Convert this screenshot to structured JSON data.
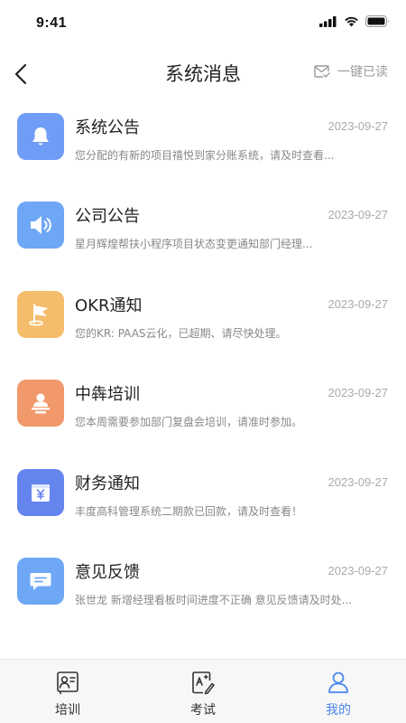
{
  "status_bar": {
    "time": "9:41"
  },
  "header": {
    "title": "系统消息",
    "mark_all_read": "一键已读"
  },
  "messages": [
    {
      "title": "系统公告",
      "date": "2023-09-27",
      "preview": "您分配的有新的项目禧悦到家分账系统，请及时查看...",
      "icon": "bell-icon",
      "color": "#6f9cf6"
    },
    {
      "title": "公司公告",
      "date": "2023-09-27",
      "preview": "星月辉煌帮扶小程序项目状态变更通知部门经理...",
      "icon": "speaker-icon",
      "color": "#6ea7f5"
    },
    {
      "title": "OKR通知",
      "date": "2023-09-27",
      "preview": "您的KR: PAAS云化，已超期、请尽快处理。",
      "icon": "flag-icon",
      "color": "#f5bd6b"
    },
    {
      "title": "中犇培训",
      "date": "2023-09-27",
      "preview": "您本周需要参加部门复盘会培训，请准时参加。",
      "icon": "lecturer-icon",
      "color": "#f1996a"
    },
    {
      "title": "财务通知",
      "date": "2023-09-27",
      "preview": "丰度高科管理系统二期款已回款，请及时查看！",
      "icon": "yuan-icon",
      "color": "#6585ee"
    },
    {
      "title": "意见反馈",
      "date": "2023-09-27",
      "preview": "张世龙  新增经理看板时间进度不正确 意见反馈请及时处...",
      "icon": "chat-icon",
      "color": "#6ea7f5"
    }
  ],
  "tabs": [
    {
      "label": "培训",
      "icon": "training-icon",
      "active": false
    },
    {
      "label": "考试",
      "icon": "exam-icon",
      "active": false
    },
    {
      "label": "我的",
      "icon": "profile-icon",
      "active": true
    }
  ],
  "colors": {
    "accent": "#4a87ef",
    "date": "#aaaaaa",
    "preview": "#888888"
  }
}
